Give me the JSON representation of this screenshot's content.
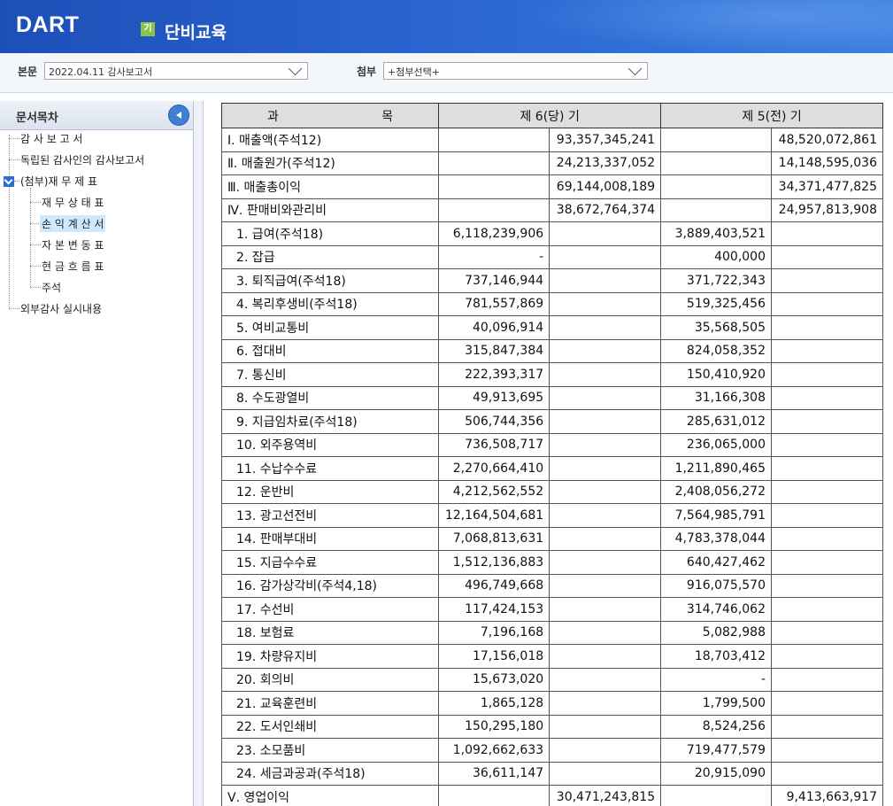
{
  "header": {
    "logo": "DART",
    "period_badge": "기",
    "company": "단비교육"
  },
  "selectors": {
    "main_label": "본문",
    "main_value": "2022.04.11  감사보고서",
    "attach_label": "첨부",
    "attach_value": "+첨부선택+"
  },
  "toc": {
    "title": "문서목차",
    "items": [
      "감 사 보 고 서",
      "독립된 감사인의 감사보고서",
      "(첨부)재 무 제 표",
      "재 무 상 태 표",
      "손 익 계 산 서",
      "자 본 변 동 표",
      "현 금 흐 름 표",
      "주석",
      "외부감사 실시내용"
    ]
  },
  "table": {
    "headers": {
      "item_a": "과",
      "item_b": "목",
      "current": "제 6(당) 기",
      "previous": "제 5(전) 기"
    },
    "rows": [
      [
        "Ⅰ. 매출액(주석12)",
        "",
        "93,357,345,241",
        "",
        "48,520,072,861"
      ],
      [
        "Ⅱ. 매출원가(주석12)",
        "",
        "24,213,337,052",
        "",
        "14,148,595,036"
      ],
      [
        "Ⅲ. 매출총이익",
        "",
        "69,144,008,189",
        "",
        "34,371,477,825"
      ],
      [
        "Ⅳ. 판매비와관리비",
        "",
        "38,672,764,374",
        "",
        "24,957,813,908"
      ],
      [
        "1. 급여(주석18)",
        "6,118,239,906",
        "",
        "3,889,403,521",
        ""
      ],
      [
        "2. 잡급",
        "-",
        "",
        "400,000",
        ""
      ],
      [
        "3. 퇴직급여(주석18)",
        "737,146,944",
        "",
        "371,722,343",
        ""
      ],
      [
        "4. 복리후생비(주석18)",
        "781,557,869",
        "",
        "519,325,456",
        ""
      ],
      [
        "5. 여비교통비",
        "40,096,914",
        "",
        "35,568,505",
        ""
      ],
      [
        "6. 접대비",
        "315,847,384",
        "",
        "824,058,352",
        ""
      ],
      [
        "7. 통신비",
        "222,393,317",
        "",
        "150,410,920",
        ""
      ],
      [
        "8. 수도광열비",
        "49,913,695",
        "",
        "31,166,308",
        ""
      ],
      [
        "9. 지급임차료(주석18)",
        "506,744,356",
        "",
        "285,631,012",
        ""
      ],
      [
        "10. 외주용역비",
        "736,508,717",
        "",
        "236,065,000",
        ""
      ],
      [
        "11. 수납수수료",
        "2,270,664,410",
        "",
        "1,211,890,465",
        ""
      ],
      [
        "12. 운반비",
        "4,212,562,552",
        "",
        "2,408,056,272",
        ""
      ],
      [
        "13. 광고선전비",
        "12,164,504,681",
        "",
        "7,564,985,791",
        ""
      ],
      [
        "14. 판매부대비",
        "7,068,813,631",
        "",
        "4,783,378,044",
        ""
      ],
      [
        "15. 지급수수료",
        "1,512,136,883",
        "",
        "640,427,462",
        ""
      ],
      [
        "16. 감가상각비(주석4,18)",
        "496,749,668",
        "",
        "916,075,570",
        ""
      ],
      [
        "17. 수선비",
        "117,424,153",
        "",
        "314,746,062",
        ""
      ],
      [
        "18. 보험료",
        "7,196,168",
        "",
        "5,082,988",
        ""
      ],
      [
        "19. 차량유지비",
        "17,156,018",
        "",
        "18,703,412",
        ""
      ],
      [
        "20. 회의비",
        "15,673,020",
        "",
        "-",
        ""
      ],
      [
        "21. 교육훈련비",
        "1,865,128",
        "",
        "1,799,500",
        ""
      ],
      [
        "22. 도서인쇄비",
        "150,295,180",
        "",
        "8,524,256",
        ""
      ],
      [
        "23. 소모품비",
        "1,092,662,633",
        "",
        "719,477,579",
        ""
      ],
      [
        "24. 세금과공과(주석18)",
        "36,611,147",
        "",
        "20,915,090",
        ""
      ],
      [
        "Ⅴ. 영업이익",
        "",
        "30,471,243,815",
        "",
        "9,413,663,917"
      ]
    ]
  }
}
